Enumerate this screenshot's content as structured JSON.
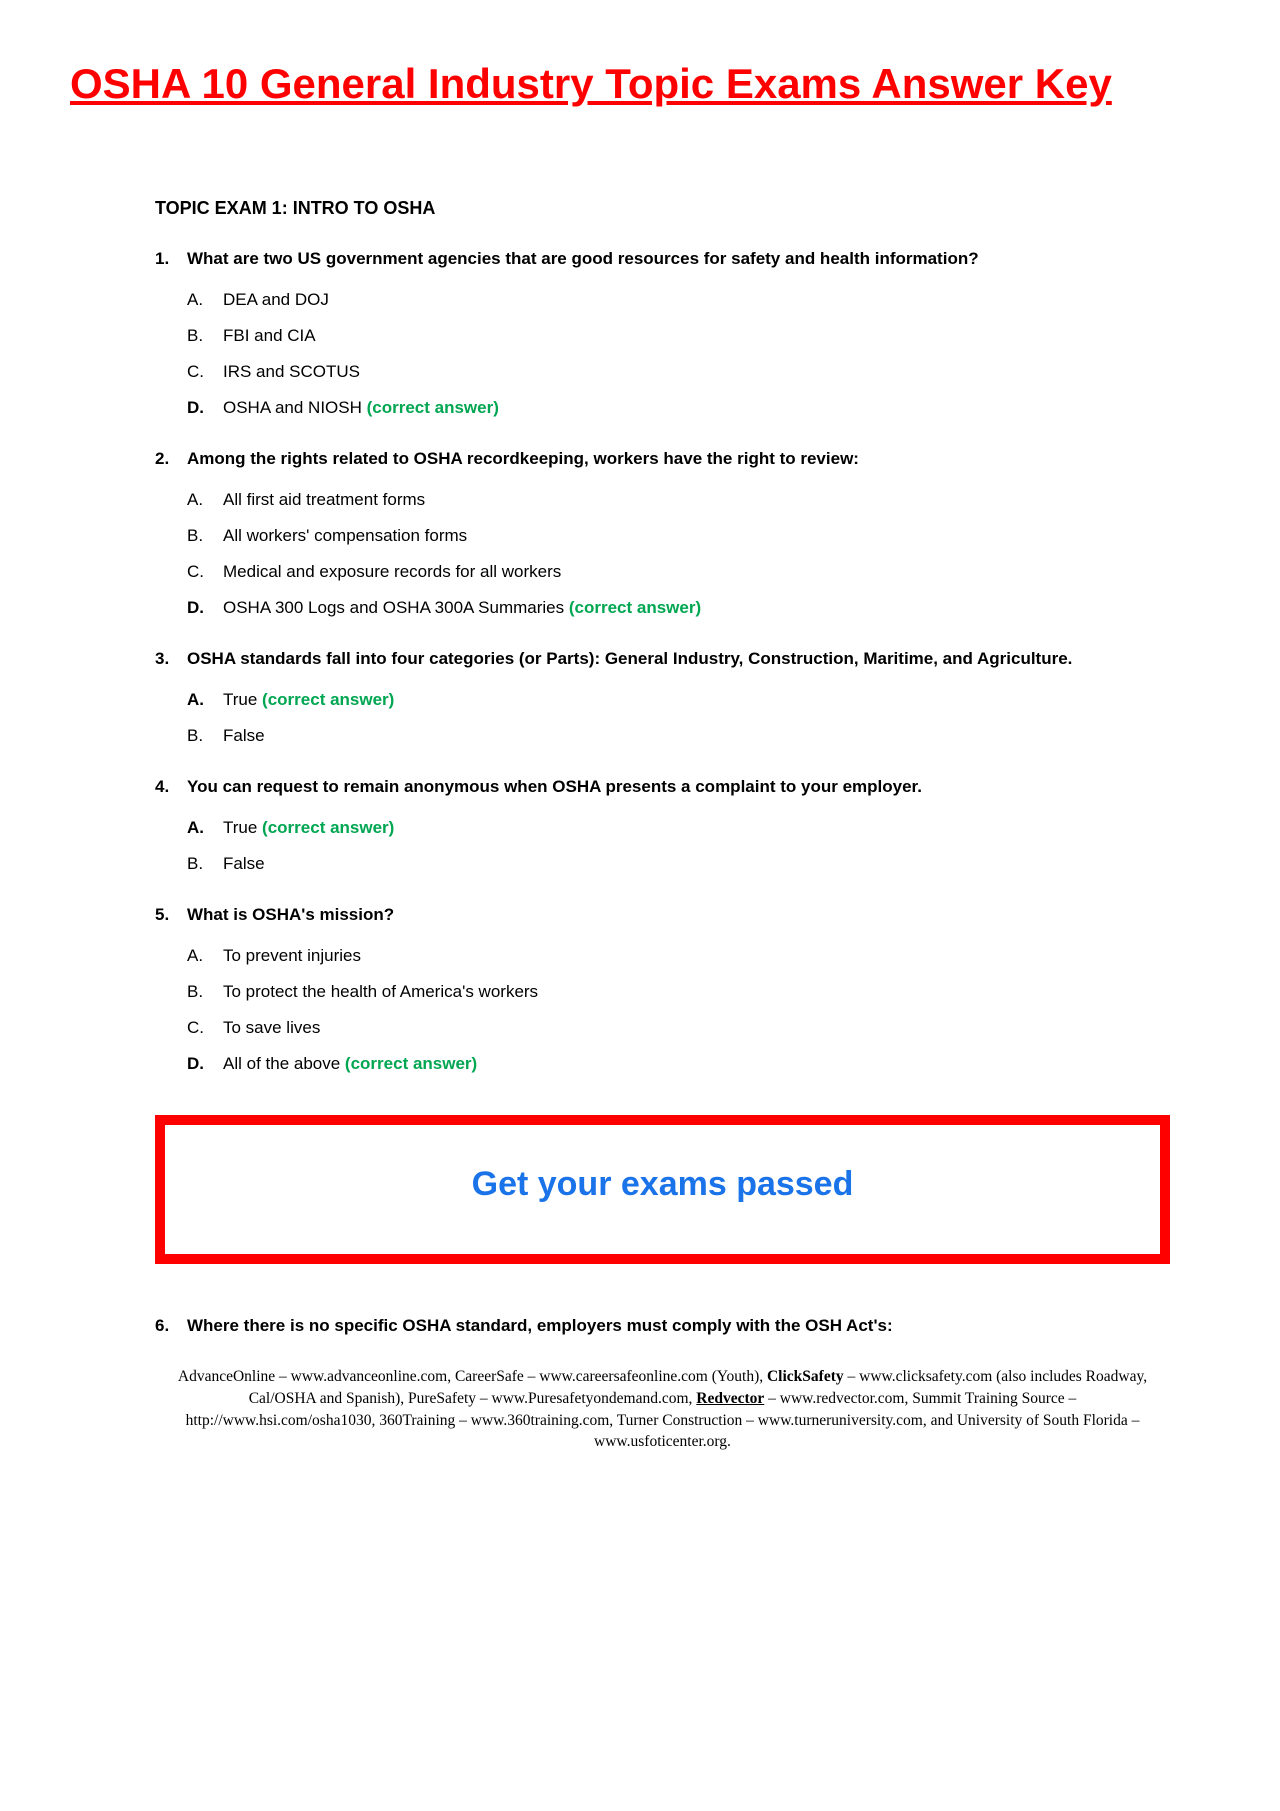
{
  "title": "OSHA 10 General Industry Topic Exams Answer Key",
  "topic_header": "TOPIC EXAM 1: INTRO TO OSHA",
  "correct_label": "(correct answer)",
  "questions": [
    {
      "num": "1.",
      "text": "What are two US government agencies that are good resources for safety and health information?",
      "answers": [
        {
          "letter": "A.",
          "text": "DEA and DOJ",
          "correct": false
        },
        {
          "letter": "B.",
          "text": "FBI and CIA",
          "correct": false
        },
        {
          "letter": "C.",
          "text": "IRS and SCOTUS",
          "correct": false
        },
        {
          "letter": "D.",
          "text": "OSHA and NIOSH",
          "correct": true
        }
      ]
    },
    {
      "num": "2.",
      "text": "Among the rights related to OSHA recordkeeping, workers have the right to review:",
      "answers": [
        {
          "letter": "A.",
          "text": "All first aid treatment forms",
          "correct": false
        },
        {
          "letter": "B.",
          "text": "All workers' compensation forms",
          "correct": false
        },
        {
          "letter": "C.",
          "text": "Medical and exposure records for all workers",
          "correct": false
        },
        {
          "letter": "D.",
          "text": "OSHA 300 Logs and OSHA 300A Summaries",
          "correct": true
        }
      ]
    },
    {
      "num": "3.",
      "text": "OSHA standards fall into four categories (or Parts): General Industry, Construction, Maritime, and Agriculture.",
      "answers": [
        {
          "letter": "A.",
          "text": "True",
          "correct": true
        },
        {
          "letter": "B.",
          "text": "False",
          "correct": false
        }
      ]
    },
    {
      "num": "4.",
      "text": "You can request to remain anonymous when OSHA presents a complaint to your employer.",
      "answers": [
        {
          "letter": "A.",
          "text": "True",
          "correct": true
        },
        {
          "letter": "B.",
          "text": "False",
          "correct": false
        }
      ]
    },
    {
      "num": "5.",
      "text": "What is OSHA's mission?",
      "answers": [
        {
          "letter": "A.",
          "text": "To prevent injuries",
          "correct": false
        },
        {
          "letter": "B.",
          "text": "To protect the health of America's workers",
          "correct": false
        },
        {
          "letter": "C.",
          "text": "To save lives",
          "correct": false
        },
        {
          "letter": "D.",
          "text": "All of the above",
          "correct": true
        }
      ]
    }
  ],
  "cta": "Get your exams passed",
  "question6": {
    "num": "6.",
    "text": "Where there is no specific OSHA standard, employers must comply with the OSH Act's:"
  },
  "footer": {
    "s1": "AdvanceOnline – www.advanceonline.com, CareerSafe – www.careersafeonline.com (Youth), ",
    "s2": "ClickSafety",
    "s3": " – www.clicksafety.com (also includes Roadway, Cal/OSHA and Spanish), PureSafety – www.Puresafetyondemand.com, ",
    "s4": "Redvector",
    "s5": " – www.redvector.com, Summit Training Source – http://www.hsi.com/osha1030, 360Training – www.360training.com, Turner Construction – www.turneruniversity.com, and University of South Florida – www.usfoticenter.org."
  }
}
